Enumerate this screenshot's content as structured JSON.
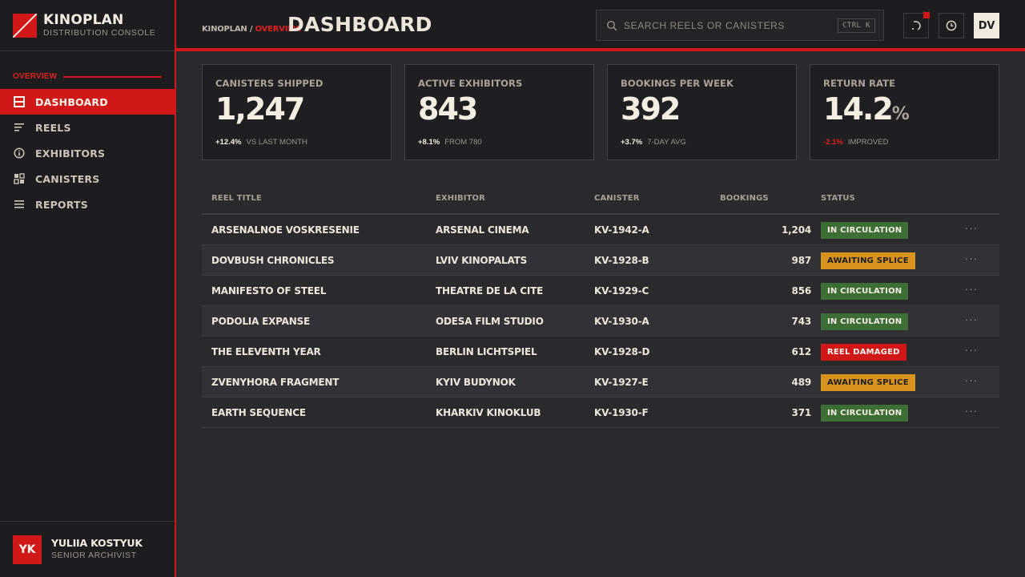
{
  "brand": {
    "name": "KINOPLAN",
    "subtitle": "DISTRIBUTION CONSOLE"
  },
  "sidebar": {
    "section": "OVERVIEW",
    "items": [
      {
        "label": "DASHBOARD",
        "icon": "dashboard-icon",
        "active": true
      },
      {
        "label": "REELS",
        "icon": "list-icon"
      },
      {
        "label": "EXHIBITORS",
        "icon": "info-icon"
      },
      {
        "label": "CANISTERS",
        "icon": "grid-icon"
      },
      {
        "label": "REPORTS",
        "icon": "menu-icon"
      }
    ],
    "user": {
      "initials": "YK",
      "name": "YULIIA KOSTYUK",
      "role": "SENIOR ARCHIVIST"
    }
  },
  "header": {
    "breadcrumb_root": "KINOPLAN",
    "breadcrumb_sep": "/",
    "breadcrumb_current": "OVERVIEW",
    "title": "DASHBOARD",
    "search_placeholder": "SEARCH REELS OR CANISTERS",
    "search_shortcut": "CTRL K",
    "user_initials": "DV"
  },
  "stats": [
    {
      "label": "CANISTERS SHIPPED",
      "value": "1,247",
      "unit": "",
      "delta": "+12.4%",
      "note": "VS LAST MONTH",
      "negative": false
    },
    {
      "label": "ACTIVE EXHIBITORS",
      "value": "843",
      "unit": "",
      "delta": "+8.1%",
      "note": "FROM 780",
      "negative": false
    },
    {
      "label": "BOOKINGS PER WEEK",
      "value": "392",
      "unit": "",
      "delta": "+3.7%",
      "note": "7-DAY AVG",
      "negative": false
    },
    {
      "label": "RETURN RATE",
      "value": "14.2",
      "unit": "%",
      "delta": "-2.1%",
      "note": "IMPROVED",
      "negative": true
    }
  ],
  "table": {
    "columns": [
      "REEL TITLE",
      "EXHIBITOR",
      "CANISTER",
      "BOOKINGS",
      "STATUS"
    ],
    "more_icon": "···",
    "rows": [
      {
        "title": "ARSENALNOE VOSKRESENIE",
        "exhibitor": "ARSENAL CINEMA",
        "canister": "KV-1942-A",
        "bookings": "1,204",
        "status": "IN CIRCULATION",
        "tone": "green"
      },
      {
        "title": "DOVBUSH CHRONICLES",
        "exhibitor": "LVIV KINOPALATS",
        "canister": "KV-1928-B",
        "bookings": "987",
        "status": "AWAITING SPLICE",
        "tone": "amber"
      },
      {
        "title": "MANIFESTO OF STEEL",
        "exhibitor": "THEATRE DE LA CITE",
        "canister": "KV-1929-C",
        "bookings": "856",
        "status": "IN CIRCULATION",
        "tone": "green"
      },
      {
        "title": "PODOLIA EXPANSE",
        "exhibitor": "ODESA FILM STUDIO",
        "canister": "KV-1930-A",
        "bookings": "743",
        "status": "IN CIRCULATION",
        "tone": "green"
      },
      {
        "title": "THE ELEVENTH YEAR",
        "exhibitor": "BERLIN LICHTSPIEL",
        "canister": "KV-1928-D",
        "bookings": "612",
        "status": "REEL DAMAGED",
        "tone": "red"
      },
      {
        "title": "ZVENYHORA FRAGMENT",
        "exhibitor": "KYIV BUDYNOK",
        "canister": "KV-1927-E",
        "bookings": "489",
        "status": "AWAITING SPLICE",
        "tone": "amber"
      },
      {
        "title": "EARTH SEQUENCE",
        "exhibitor": "KHARKIV KINOKLUB",
        "canister": "KV-1930-F",
        "bookings": "371",
        "status": "IN CIRCULATION",
        "tone": "green"
      }
    ]
  },
  "colors": {
    "accent": "#d01818",
    "green": "#3d6e35",
    "amber": "#d7941c",
    "background": "#2a2a2d",
    "panel": "#1d1d1f"
  }
}
